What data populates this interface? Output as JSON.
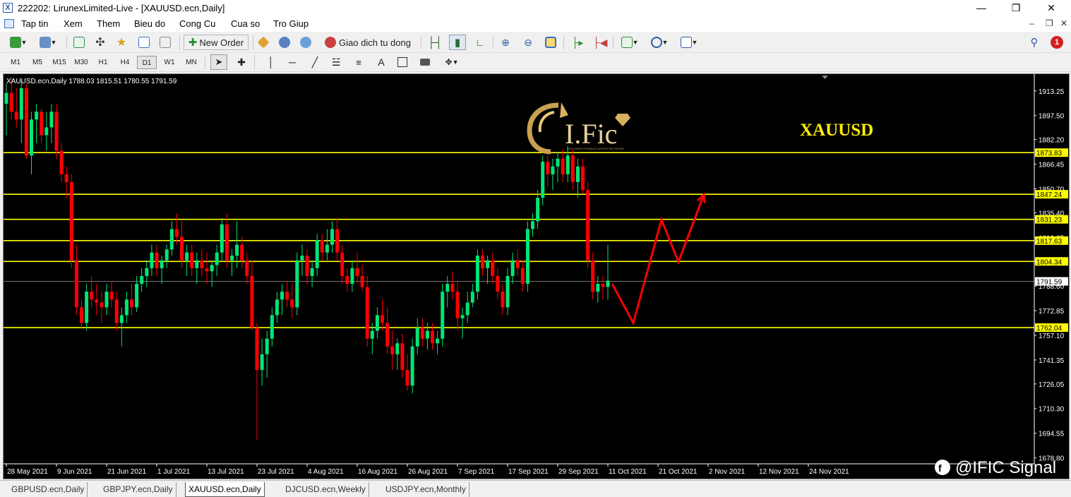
{
  "window": {
    "title": "222202: LirunexLimited-Live - [XAUUSD.ecn,Daily]"
  },
  "menu": [
    "Tap tin",
    "Xem",
    "Them",
    "Bieu do",
    "Cong Cu",
    "Cua so",
    "Tro Giup"
  ],
  "toolbar": {
    "new_order": "New Order",
    "auto_trading": "Giao dich tu dong",
    "notification_count": "1"
  },
  "timeframes": [
    "M1",
    "M5",
    "M15",
    "M30",
    "H1",
    "H4",
    "D1",
    "W1",
    "MN"
  ],
  "active_timeframe": "D1",
  "drawing_tools": {
    "text_tool": "A"
  },
  "chart": {
    "header": "XAUUSD.ecn,Daily  1788.03 1815.51 1780.55 1791.59",
    "overlay_symbol": "XAUUSD",
    "logo_text": "I.Fic",
    "logo_tagline": "EXPLORING FINANCE INSIGHT NETWORK",
    "watermark": "@IFIC Signal",
    "colors": {
      "background": "#000000",
      "bull": "#00e676",
      "bear": "#ff0000",
      "level": "#ffff00",
      "arrow": "#ff0000",
      "overlay_text": "#ffff00"
    }
  },
  "chart_data": {
    "type": "candlestick",
    "symbol": "XAUUSD.ecn",
    "timeframe": "Daily",
    "last": {
      "open": 1788.03,
      "high": 1815.51,
      "low": 1780.55,
      "close": 1791.59
    },
    "y_ticks": [
      1913.25,
      1897.5,
      1882.2,
      1866.45,
      1850.7,
      1835.4,
      1819.65,
      1804.35,
      1788.6,
      1772.85,
      1757.1,
      1741.35,
      1726.05,
      1710.3,
      1694.55,
      1678.8
    ],
    "ylim": [
      1675,
      1924
    ],
    "x_ticks": [
      "28 May 2021",
      "9 Jun 2021",
      "21 Jun 2021",
      "1 Jul 2021",
      "13 Jul 2021",
      "23 Jul 2021",
      "4 Aug 2021",
      "16 Aug 2021",
      "26 Aug 2021",
      "7 Sep 2021",
      "17 Sep 2021",
      "29 Sep 2021",
      "11 Oct 2021",
      "21 Oct 2021",
      "2 Nov 2021",
      "12 Nov 2021",
      "24 Nov 2021"
    ],
    "x_tick_bar_index": [
      0,
      10,
      20,
      30,
      40,
      50,
      60,
      70,
      80,
      90,
      100,
      110,
      120,
      130,
      140,
      150,
      160
    ],
    "levels": [
      1873.83,
      1847.24,
      1831.23,
      1817.63,
      1804.34,
      1762.04
    ],
    "current_price": 1791.59,
    "candles": [
      [
        1905,
        1918,
        1885,
        1912
      ],
      [
        1912,
        1922,
        1895,
        1900
      ],
      [
        1900,
        1915,
        1890,
        1895
      ],
      [
        1895,
        1920,
        1880,
        1915
      ],
      [
        1915,
        1918,
        1870,
        1872
      ],
      [
        1872,
        1900,
        1860,
        1895
      ],
      [
        1895,
        1905,
        1880,
        1900
      ],
      [
        1900,
        1902,
        1880,
        1885
      ],
      [
        1885,
        1900,
        1875,
        1890
      ],
      [
        1890,
        1905,
        1880,
        1900
      ],
      [
        1900,
        1905,
        1870,
        1875
      ],
      [
        1875,
        1880,
        1855,
        1860
      ],
      [
        1860,
        1865,
        1845,
        1855
      ],
      [
        1855,
        1860,
        1800,
        1805
      ],
      [
        1805,
        1815,
        1770,
        1775
      ],
      [
        1775,
        1780,
        1762,
        1765
      ],
      [
        1765,
        1790,
        1760,
        1785
      ],
      [
        1785,
        1795,
        1775,
        1780
      ],
      [
        1780,
        1790,
        1770,
        1778
      ],
      [
        1778,
        1785,
        1765,
        1775
      ],
      [
        1775,
        1790,
        1770,
        1785
      ],
      [
        1785,
        1792,
        1775,
        1780
      ],
      [
        1780,
        1785,
        1760,
        1765
      ],
      [
        1765,
        1775,
        1750,
        1770
      ],
      [
        1770,
        1785,
        1765,
        1780
      ],
      [
        1780,
        1790,
        1770,
        1775
      ],
      [
        1775,
        1795,
        1772,
        1790
      ],
      [
        1790,
        1800,
        1785,
        1795
      ],
      [
        1795,
        1805,
        1788,
        1800
      ],
      [
        1800,
        1815,
        1795,
        1810
      ],
      [
        1810,
        1815,
        1795,
        1800
      ],
      [
        1800,
        1808,
        1790,
        1805
      ],
      [
        1805,
        1815,
        1800,
        1812
      ],
      [
        1812,
        1830,
        1808,
        1825
      ],
      [
        1825,
        1835,
        1815,
        1820
      ],
      [
        1820,
        1830,
        1800,
        1805
      ],
      [
        1805,
        1815,
        1795,
        1810
      ],
      [
        1810,
        1815,
        1795,
        1800
      ],
      [
        1800,
        1810,
        1790,
        1805
      ],
      [
        1805,
        1812,
        1795,
        1800
      ],
      [
        1800,
        1810,
        1790,
        1798
      ],
      [
        1798,
        1805,
        1788,
        1802
      ],
      [
        1802,
        1815,
        1795,
        1810
      ],
      [
        1810,
        1832,
        1805,
        1828
      ],
      [
        1828,
        1835,
        1800,
        1805
      ],
      [
        1805,
        1812,
        1795,
        1808
      ],
      [
        1808,
        1830,
        1800,
        1815
      ],
      [
        1815,
        1820,
        1800,
        1805
      ],
      [
        1805,
        1810,
        1790,
        1795
      ],
      [
        1795,
        1805,
        1760,
        1762
      ],
      [
        1762,
        1765,
        1690,
        1735
      ],
      [
        1735,
        1755,
        1725,
        1745
      ],
      [
        1745,
        1760,
        1730,
        1755
      ],
      [
        1755,
        1775,
        1750,
        1770
      ],
      [
        1770,
        1785,
        1765,
        1780
      ],
      [
        1780,
        1790,
        1770,
        1785
      ],
      [
        1785,
        1792,
        1775,
        1780
      ],
      [
        1780,
        1790,
        1768,
        1775
      ],
      [
        1775,
        1810,
        1770,
        1805
      ],
      [
        1805,
        1815,
        1795,
        1808
      ],
      [
        1808,
        1812,
        1790,
        1795
      ],
      [
        1795,
        1805,
        1788,
        1800
      ],
      [
        1800,
        1822,
        1795,
        1818
      ],
      [
        1818,
        1822,
        1805,
        1810
      ],
      [
        1810,
        1825,
        1805,
        1815
      ],
      [
        1815,
        1830,
        1810,
        1825
      ],
      [
        1825,
        1832,
        1805,
        1810
      ],
      [
        1810,
        1815,
        1790,
        1795
      ],
      [
        1795,
        1800,
        1785,
        1790
      ],
      [
        1790,
        1805,
        1785,
        1800
      ],
      [
        1800,
        1810,
        1790,
        1795
      ],
      [
        1795,
        1802,
        1785,
        1788
      ],
      [
        1788,
        1795,
        1750,
        1755
      ],
      [
        1755,
        1765,
        1745,
        1760
      ],
      [
        1760,
        1775,
        1755,
        1770
      ],
      [
        1770,
        1780,
        1760,
        1765
      ],
      [
        1765,
        1775,
        1745,
        1750
      ],
      [
        1750,
        1760,
        1735,
        1745
      ],
      [
        1745,
        1755,
        1735,
        1752
      ],
      [
        1752,
        1758,
        1730,
        1735
      ],
      [
        1735,
        1745,
        1722,
        1725
      ],
      [
        1725,
        1755,
        1720,
        1750
      ],
      [
        1750,
        1768,
        1745,
        1762
      ],
      [
        1762,
        1768,
        1750,
        1755
      ],
      [
        1755,
        1765,
        1748,
        1760
      ],
      [
        1760,
        1765,
        1748,
        1752
      ],
      [
        1752,
        1760,
        1745,
        1755
      ],
      [
        1755,
        1790,
        1750,
        1785
      ],
      [
        1785,
        1795,
        1775,
        1790
      ],
      [
        1790,
        1798,
        1780,
        1785
      ],
      [
        1785,
        1792,
        1760,
        1768
      ],
      [
        1768,
        1775,
        1755,
        1770
      ],
      [
        1770,
        1785,
        1765,
        1778
      ],
      [
        1778,
        1790,
        1775,
        1785
      ],
      [
        1785,
        1812,
        1780,
        1808
      ],
      [
        1808,
        1812,
        1795,
        1800
      ],
      [
        1800,
        1808,
        1790,
        1805
      ],
      [
        1805,
        1810,
        1790,
        1795
      ],
      [
        1795,
        1800,
        1780,
        1785
      ],
      [
        1785,
        1790,
        1770,
        1775
      ],
      [
        1775,
        1800,
        1770,
        1795
      ],
      [
        1795,
        1810,
        1790,
        1805
      ],
      [
        1805,
        1812,
        1795,
        1800
      ],
      [
        1800,
        1805,
        1785,
        1790
      ],
      [
        1790,
        1830,
        1785,
        1825
      ],
      [
        1825,
        1835,
        1820,
        1830
      ],
      [
        1830,
        1850,
        1825,
        1845
      ],
      [
        1845,
        1872,
        1840,
        1868
      ],
      [
        1868,
        1872,
        1852,
        1860
      ],
      [
        1860,
        1870,
        1850,
        1865
      ],
      [
        1865,
        1874,
        1855,
        1870
      ],
      [
        1870,
        1876,
        1855,
        1860
      ],
      [
        1860,
        1878,
        1855,
        1872
      ],
      [
        1872,
        1876,
        1850,
        1855
      ],
      [
        1855,
        1870,
        1845,
        1865
      ],
      [
        1865,
        1870,
        1848,
        1850
      ],
      [
        1850,
        1855,
        1800,
        1805
      ],
      [
        1805,
        1810,
        1780,
        1785
      ],
      [
        1785,
        1795,
        1778,
        1790
      ],
      [
        1790,
        1795,
        1780,
        1788
      ],
      [
        1788,
        1815,
        1780,
        1792
      ]
    ],
    "candles_x_offset": 0
  }
}
